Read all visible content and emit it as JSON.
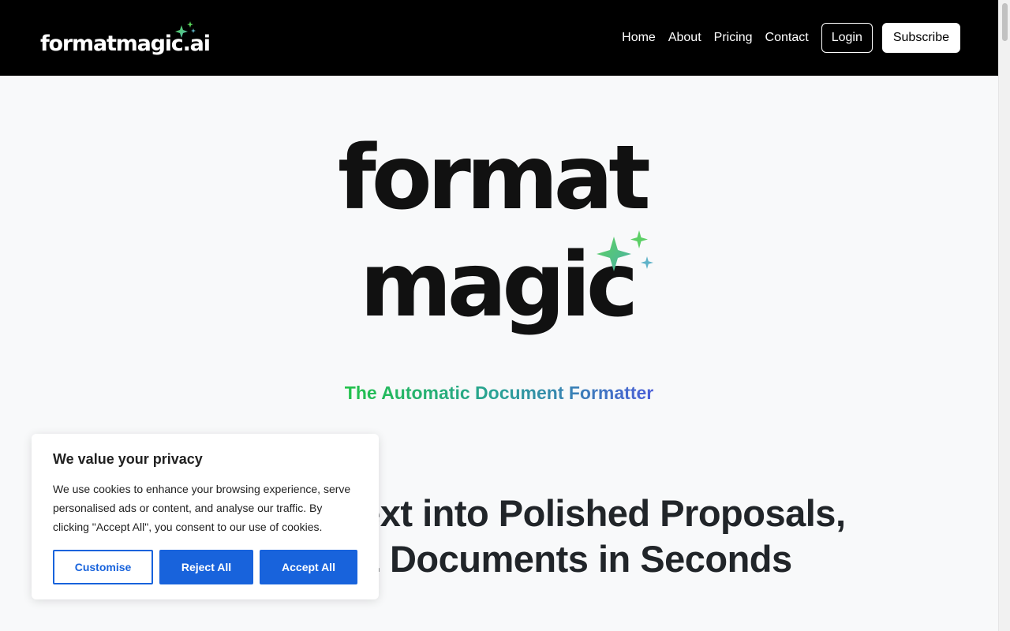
{
  "header": {
    "brand": "formatmagic.ai",
    "nav": [
      "Home",
      "About",
      "Pricing",
      "Contact"
    ],
    "login_label": "Login",
    "subscribe_label": "Subscribe"
  },
  "hero": {
    "logo_line1": "format",
    "logo_line2": "magic",
    "tagline": "The Automatic Document Formatter",
    "headline_line1": "Transform Text into Polished Proposals,",
    "headline_line2": "Reports & Documents in Seconds"
  },
  "cookie_banner": {
    "title": "We value your privacy",
    "text": "We use cookies to enhance your browsing experience, serve personalised ads or content, and analyse our traffic. By clicking \"Accept All\", you consent to our use of cookies.",
    "customise_label": "Customise",
    "reject_label": "Reject All",
    "accept_label": "Accept All"
  },
  "colors": {
    "header_bg": "#000000",
    "page_bg": "#f8f9fa",
    "cookie_accent": "#1863dc",
    "tagline_green": "#22c24a",
    "tagline_blue": "#4c5fd8"
  },
  "icons": {
    "brand_sparkle": "sparkle-icon",
    "logo_sparkle": "sparkle-icon"
  }
}
